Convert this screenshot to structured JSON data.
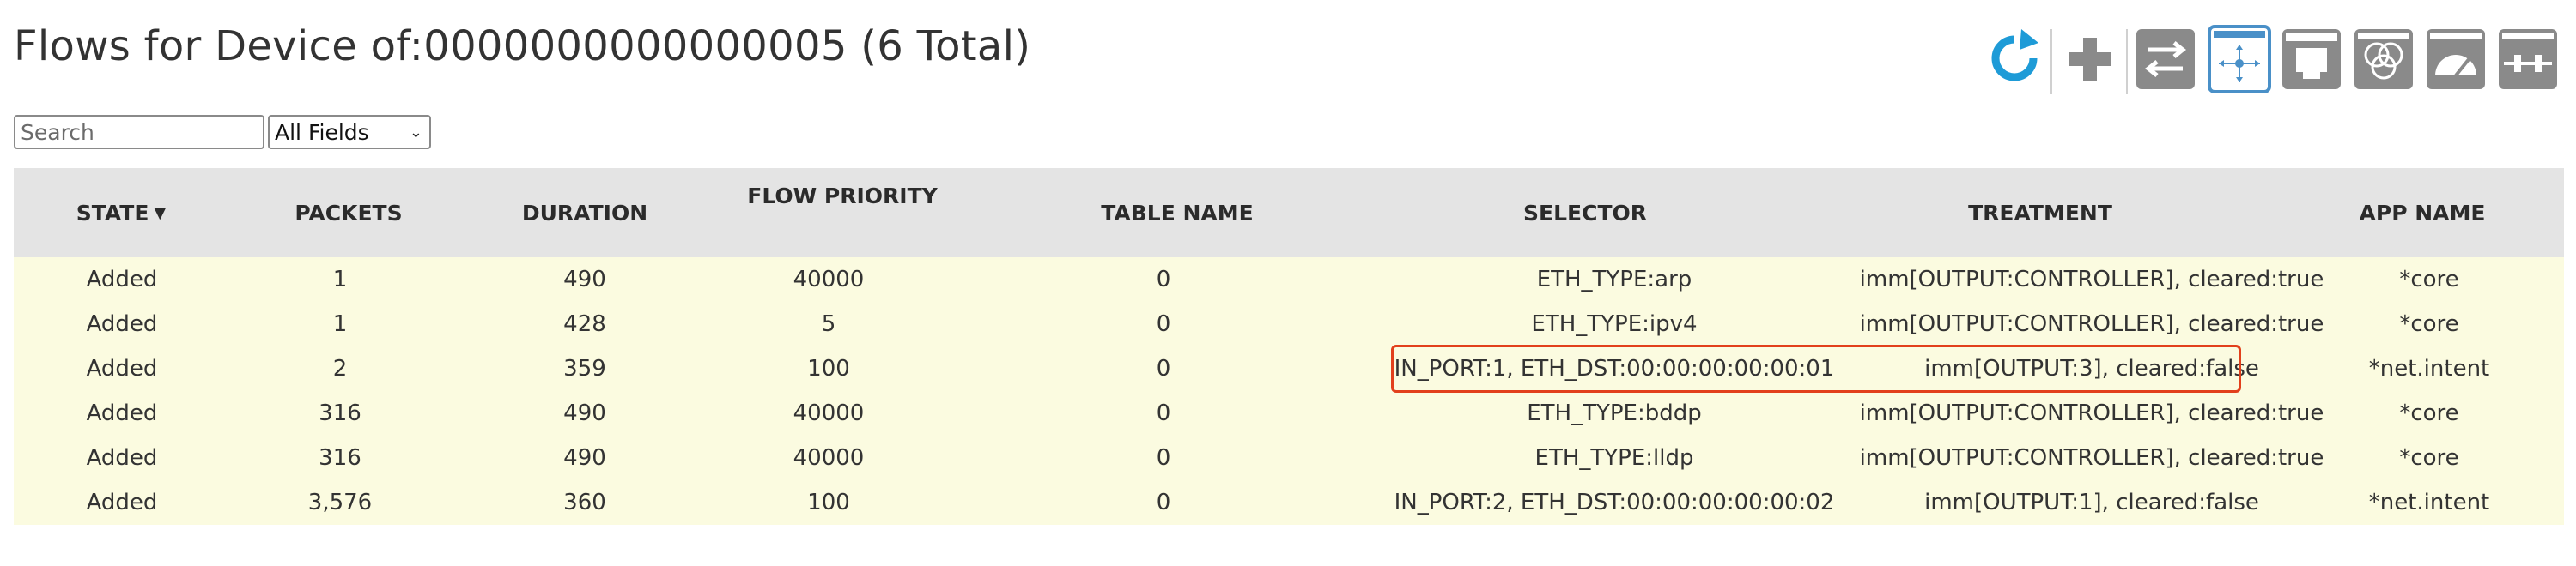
{
  "page": {
    "title": "Flows for Device of:0000000000000005 (6 Total)"
  },
  "toolbar": {
    "icons": [
      {
        "name": "refresh-icon",
        "color": "#1e9bd7"
      },
      {
        "name": "add-flow-icon",
        "color": "#8a8a8a"
      },
      {
        "name": "switch-view-icon",
        "color": "#8a8a8a"
      },
      {
        "name": "flow-view-icon",
        "color": "#4a90c8",
        "selected": true
      },
      {
        "name": "port-view-icon",
        "color": "#8a8a8a"
      },
      {
        "name": "group-view-icon",
        "color": "#8a8a8a"
      },
      {
        "name": "meter-view-icon",
        "color": "#8a8a8a"
      },
      {
        "name": "pipeconf-view-icon",
        "color": "#8a8a8a"
      }
    ]
  },
  "search": {
    "placeholder": "Search",
    "value": "",
    "field_selected": "All Fields"
  },
  "table": {
    "columns": [
      {
        "label": "STATE",
        "sorted": "desc"
      },
      {
        "label": "PACKETS"
      },
      {
        "label": "DURATION"
      },
      {
        "label": "FLOW PRIORITY"
      },
      {
        "label": "TABLE NAME"
      },
      {
        "label": "SELECTOR"
      },
      {
        "label": "TREATMENT"
      },
      {
        "label": "APP NAME"
      }
    ],
    "rows": [
      {
        "state": "Added",
        "packets": "1",
        "duration": "490",
        "priority": "40000",
        "table": "0",
        "selector": "ETH_TYPE:arp",
        "treatment": "imm[OUTPUT:CONTROLLER], cleared:true",
        "app": "*core"
      },
      {
        "state": "Added",
        "packets": "1",
        "duration": "428",
        "priority": "5",
        "table": "0",
        "selector": "ETH_TYPE:ipv4",
        "treatment": "imm[OUTPUT:CONTROLLER], cleared:true",
        "app": "*core"
      },
      {
        "state": "Added",
        "packets": "2",
        "duration": "359",
        "priority": "100",
        "table": "0",
        "selector": "IN_PORT:1, ETH_DST:00:00:00:00:00:01",
        "treatment": "imm[OUTPUT:3], cleared:false",
        "app": "*net.intent",
        "highlighted": true
      },
      {
        "state": "Added",
        "packets": "316",
        "duration": "490",
        "priority": "40000",
        "table": "0",
        "selector": "ETH_TYPE:bddp",
        "treatment": "imm[OUTPUT:CONTROLLER], cleared:true",
        "app": "*core"
      },
      {
        "state": "Added",
        "packets": "316",
        "duration": "490",
        "priority": "40000",
        "table": "0",
        "selector": "ETH_TYPE:lldp",
        "treatment": "imm[OUTPUT:CONTROLLER], cleared:true",
        "app": "*core"
      },
      {
        "state": "Added",
        "packets": "3,576",
        "duration": "360",
        "priority": "100",
        "table": "0",
        "selector": "IN_PORT:2, ETH_DST:00:00:00:00:00:02",
        "treatment": "imm[OUTPUT:1], cleared:false",
        "app": "*net.intent"
      }
    ]
  },
  "colors": {
    "header_bg": "#e4e4e4",
    "row_bg": "#fbfbe0",
    "highlight": "#e2401c",
    "accent": "#1e9bd7"
  }
}
